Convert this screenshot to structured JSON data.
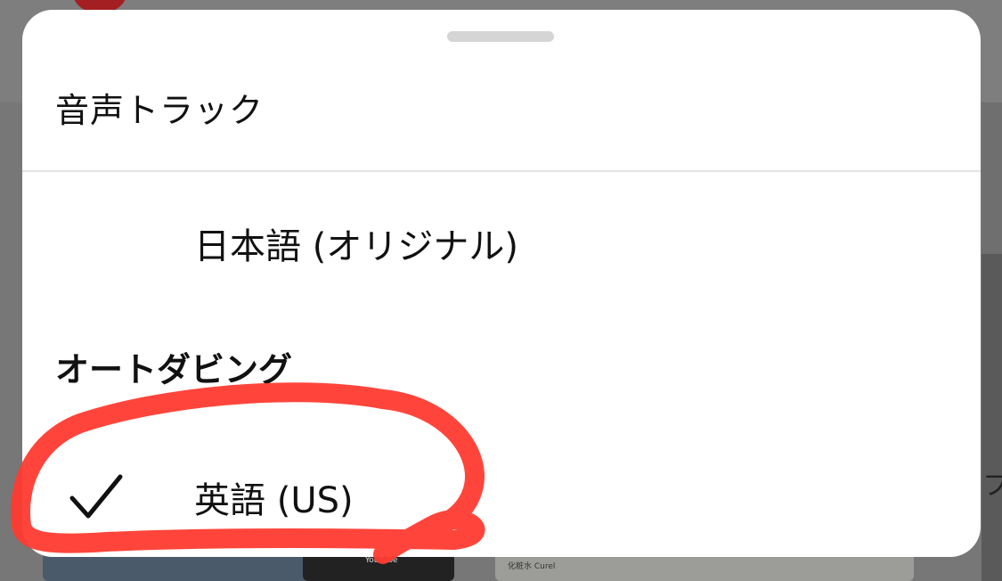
{
  "sheet": {
    "title": "音声トラック",
    "original_track": "日本語 (オリジナル)",
    "section_header": "オートダビング",
    "dubbed_tracks": [
      {
        "label": "英語 (US)",
        "selected": true,
        "icon": "checkmark-icon"
      }
    ]
  },
  "background": {
    "right_edge_char": "フ",
    "thumb_label": "YouTube",
    "thumb_text": "化粧水 Curel"
  },
  "colors": {
    "sheet_bg": "#ffffff",
    "overlay": "#777777",
    "annotation": "#ff3b30",
    "text": "#111111"
  }
}
